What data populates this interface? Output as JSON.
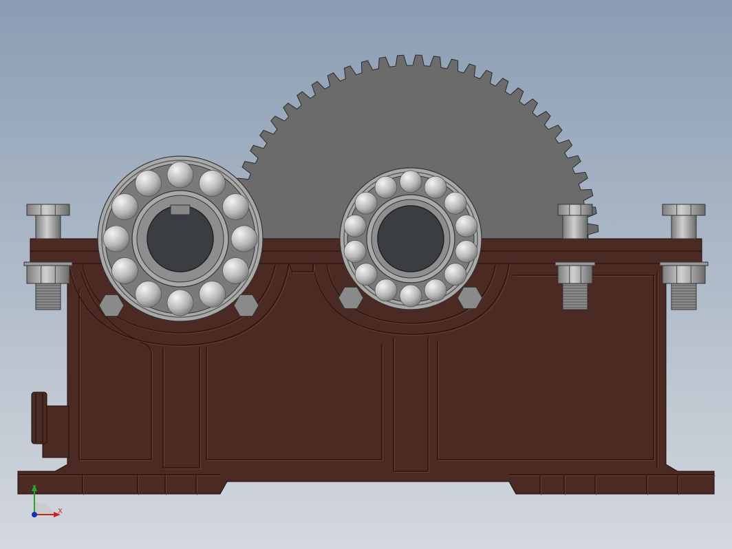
{
  "colors": {
    "bg_top": "#8A9DB3",
    "bg_bottom": "#D4D8DE",
    "housing": "#4A2A22",
    "housing_light": "#6E3A2E",
    "housing_edge": "#1E0E0A",
    "gear": "#6B6B6B",
    "gear_edge": "#2A2A2A",
    "steel": "#A9A9A9",
    "steel_dark": "#5E5E5E",
    "shaft_hole": "#3A3E42",
    "ball": "#C8C8C8",
    "axis_x": "#D22020",
    "axis_y": "#2EA02E",
    "axis_z": "#1030C0"
  },
  "gear": {
    "teeth": 64
  },
  "bearings": [
    {
      "name": "bearing-left",
      "balls": 12
    },
    {
      "name": "bearing-right",
      "balls": 14
    }
  ],
  "triad": {
    "x_label": "X",
    "y_label": "Y"
  }
}
